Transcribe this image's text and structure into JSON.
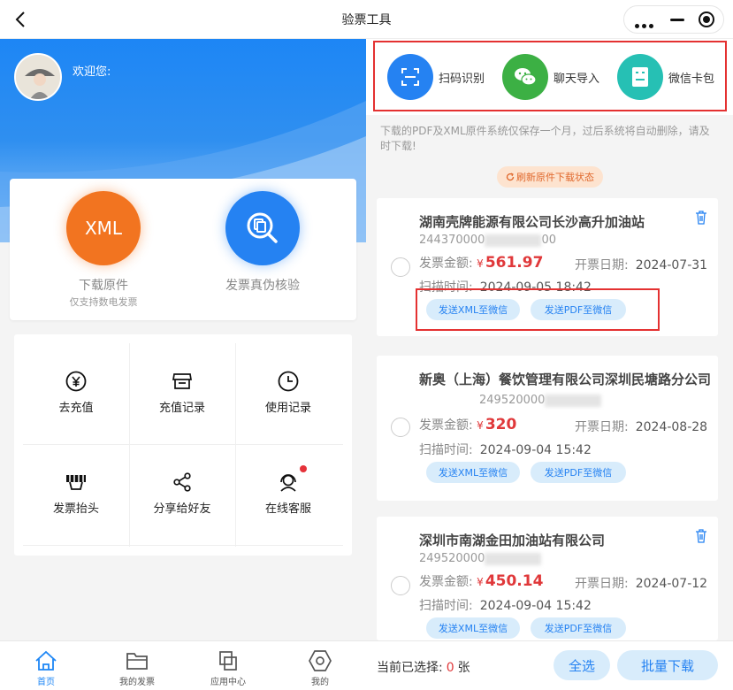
{
  "titlebar": {
    "title": "验票工具"
  },
  "user": {
    "welcome": "欢迎您:",
    "name": ""
  },
  "main_actions": [
    {
      "icon_text": "XML",
      "label": "下载原件",
      "sub": "仅支持数电发票"
    },
    {
      "label": "发票真伪核验"
    }
  ],
  "grid": [
    {
      "icon": "yen-circle-icon",
      "label": "去充值"
    },
    {
      "icon": "store-icon",
      "label": "充值记录"
    },
    {
      "icon": "clock-icon",
      "label": "使用记录"
    },
    {
      "icon": "invoice-header-icon",
      "label": "发票抬头"
    },
    {
      "icon": "share-icon",
      "label": "分享给好友"
    },
    {
      "icon": "customer-service-icon",
      "label": "在线客服"
    }
  ],
  "tabs": [
    {
      "icon": "home-icon",
      "label": "首页",
      "active": true
    },
    {
      "icon": "folder-icon",
      "label": "我的发票",
      "active": false
    },
    {
      "icon": "apps-icon",
      "label": "应用中心",
      "active": false
    },
    {
      "icon": "hexagon-icon",
      "label": "我的",
      "active": false
    }
  ],
  "tools": [
    {
      "icon": "scan-icon",
      "label": "扫码识别",
      "color": "#2582f2"
    },
    {
      "icon": "wechat-icon",
      "label": "聊天导入",
      "color": "#3cb044"
    },
    {
      "icon": "card-icon",
      "label": "微信卡包",
      "color": "#26c0b4"
    }
  ],
  "notice": "下载的PDF及XML原件系统仅保存一个月，过后系统将自动删除，请及时下载!",
  "refresh_label": "刷新原件下载状态",
  "invoices": [
    {
      "name": "湖南壳牌能源有限公司长沙高升加油站",
      "code_prefix": "244370000",
      "code_suffix": "00",
      "amount_label": "发票金额:",
      "currency": "¥",
      "amount": "561.97",
      "date_label": "开票日期:",
      "date": "2024-07-31",
      "scan_label": "扫描时间:",
      "scan_time": "2024-09-05 18:42"
    },
    {
      "name": "新奥（上海）餐饮管理有限公司深圳民塘路分公司",
      "code_prefix": "249520000",
      "code_suffix": "",
      "amount_label": "发票金额:",
      "currency": "¥",
      "amount": "320",
      "date_label": "开票日期:",
      "date": "2024-08-28",
      "scan_label": "扫描时间:",
      "scan_time": "2024-09-04 15:42"
    },
    {
      "name": "深圳市南湖金田加油站有限公司",
      "code_prefix": "249520000",
      "code_suffix": "",
      "amount_label": "发票金额:",
      "currency": "¥",
      "amount": "450.14",
      "date_label": "开票日期:",
      "date": "2024-07-12",
      "scan_label": "扫描时间:",
      "scan_time": "2024-09-04 15:42"
    }
  ],
  "send_xml_label": "发送XML至微信",
  "send_pdf_label": "发送PDF至微信",
  "bottom": {
    "selected_label": "当前已选择:",
    "selected_count": "0",
    "unit": "张",
    "select_all": "全选",
    "batch_download": "批量下载"
  }
}
